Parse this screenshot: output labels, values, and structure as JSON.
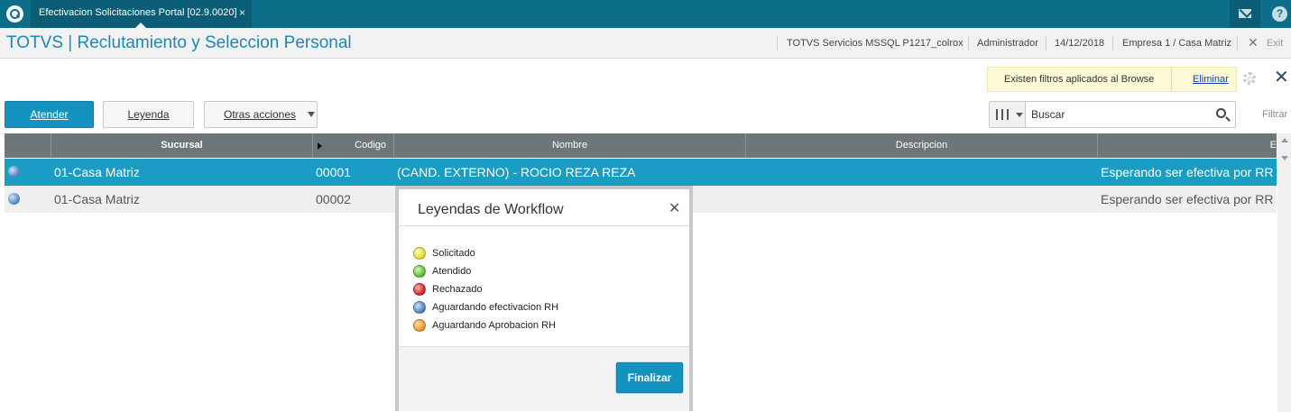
{
  "window": {
    "tab_title": "Efectivacion Solicitaciones Portal [02.9.0020]",
    "tab_close": "×",
    "help_label": "?"
  },
  "header": {
    "app_title": "TOTVS | Reclutamiento y Seleccion Personal",
    "environment": "TOTVS Servicios MSSQL P1217_colrox",
    "user": "Administrador",
    "date": "14/12/2018",
    "company": "Empresa 1 / Casa Matriz",
    "exit_label": "Exit",
    "exit_icon": "✕"
  },
  "filter_notice": {
    "text": "Existen filtros aplicados al Browse",
    "link": "Eliminar",
    "close_icon": "✕"
  },
  "toolbar": {
    "atender_label": "Atender",
    "leyenda_label": "Leyenda",
    "otras_label": "Otras acciones"
  },
  "search": {
    "placeholder": "Buscar",
    "filter_label": "Filtrar"
  },
  "grid": {
    "columns": [
      "Sucursal",
      "Codigo",
      "Nombre",
      "Descripcion",
      "E"
    ],
    "rows": [
      {
        "status_color": "#5b8cc7",
        "sucursal": "01-Casa Matriz",
        "codigo": "00001",
        "nombre": "(CAND. EXTERNO) - ROCIO REZA REZA",
        "descripcion": "",
        "estado": "Esperando ser efectiva por RR"
      },
      {
        "status_color": "#5b8cc7",
        "sucursal": "01-Casa Matriz",
        "codigo": "00002",
        "nombre": "",
        "descripcion": "",
        "estado": "Esperando ser efectiva por RR"
      }
    ]
  },
  "modal": {
    "title": "Leyendas de Workflow",
    "close_icon": "✕",
    "items": [
      {
        "label": "Solicitado",
        "color": "#e6e13a"
      },
      {
        "label": "Atendido",
        "color": "#66c33d"
      },
      {
        "label": "Rechazado",
        "color": "#d93131"
      },
      {
        "label": "Aguardando efectivacion RH",
        "color": "#5b8cc7"
      },
      {
        "label": "Aguardando Aprobacion RH",
        "color": "#f0a035"
      }
    ],
    "button_label": "Finalizar"
  }
}
